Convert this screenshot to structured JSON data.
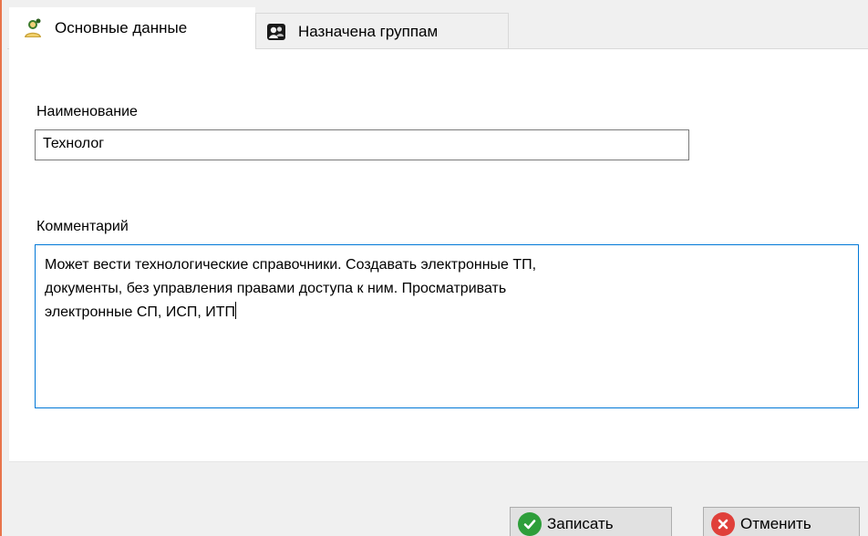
{
  "tabs": [
    {
      "label": "Основные данные",
      "icon": "user-settings-icon",
      "active": true
    },
    {
      "label": "Назначена группам",
      "icon": "groups-icon",
      "active": false
    }
  ],
  "form": {
    "name_label": "Наименование",
    "name_value": "Технолог",
    "comment_label": "Комментарий",
    "comment_value": "Может вести технологические справочники. Создавать электронные ТП,\nдокументы, без управления правами доступа к ним. Просматривать\nэлектронные СП, ИСП, ИТП"
  },
  "buttons": {
    "save_label": "Записать",
    "save_icon": "check-circle-icon",
    "save_color": "#2e9e3a",
    "cancel_label": "Отменить",
    "cancel_icon": "x-circle-icon",
    "cancel_color": "#e0403a"
  },
  "colors": {
    "accent_focus": "#0078d7",
    "window_border": "#e8744b"
  }
}
